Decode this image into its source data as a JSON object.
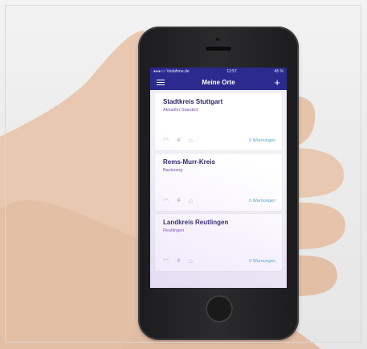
{
  "status_bar": {
    "carrier": "●●●○○ Vodafone.de",
    "time": "12:57",
    "battery": "45 %"
  },
  "nav": {
    "title": "Meine Orte",
    "add_symbol": "+"
  },
  "cards": [
    {
      "title": "Stadtkreis Stuttgart",
      "subtitle": "Aktueller Standort",
      "warnings": "0 Warnungen"
    },
    {
      "title": "Rems-Murr-Kreis",
      "subtitle": "Backnang",
      "warnings": "0 Warnungen"
    },
    {
      "title": "Landkreis Reutlingen",
      "subtitle": "Reutlingen",
      "warnings": "0 Warnungen"
    }
  ],
  "colors": {
    "header": "#2c2a8e",
    "card_title": "#2b2563",
    "subtitle": "#7d4ab3",
    "warnings": "#4aa9c8"
  }
}
